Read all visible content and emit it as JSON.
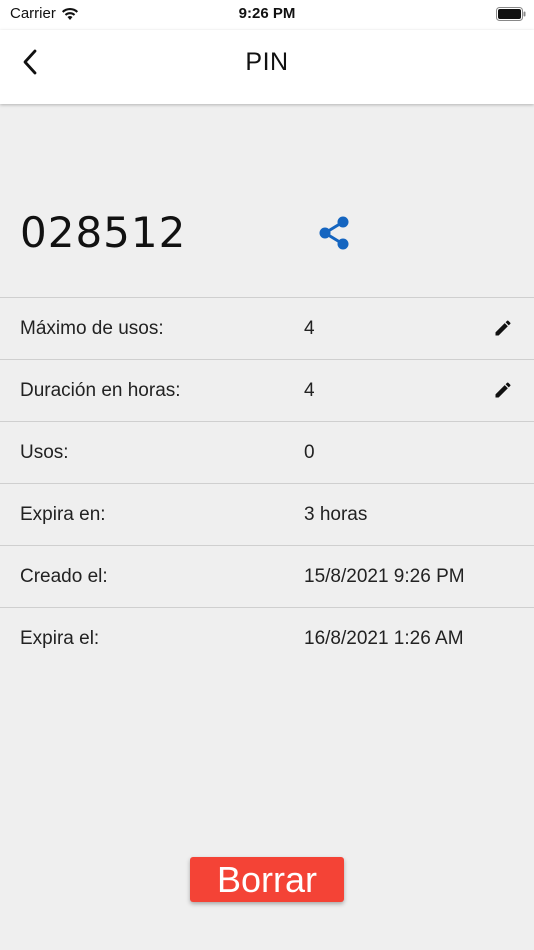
{
  "status_bar": {
    "carrier": "Carrier",
    "time": "9:26 PM"
  },
  "nav": {
    "title": "PIN"
  },
  "pin": {
    "code": "028512"
  },
  "details": [
    {
      "label": "Máximo de usos:",
      "value": "4",
      "editable": true
    },
    {
      "label": "Duración en horas:",
      "value": "4",
      "editable": true
    },
    {
      "label": "Usos:",
      "value": "0",
      "editable": false
    },
    {
      "label": "Expira en:",
      "value": "3 horas",
      "editable": false
    },
    {
      "label": "Creado el:",
      "value": "15/8/2021 9:26 PM",
      "editable": false
    },
    {
      "label": "Expira el:",
      "value": "16/8/2021 1:26 AM",
      "editable": false
    }
  ],
  "actions": {
    "delete_label": "Borrar"
  },
  "colors": {
    "accent": "#1565c0",
    "danger": "#f44336"
  }
}
